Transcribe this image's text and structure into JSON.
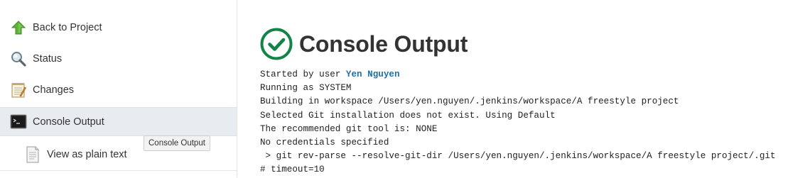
{
  "sidebar": {
    "items": [
      {
        "label": "Back to Project",
        "icon": "up-arrow-icon"
      },
      {
        "label": "Status",
        "icon": "magnifier-icon"
      },
      {
        "label": "Changes",
        "icon": "notepad-icon"
      },
      {
        "label": "Console Output",
        "icon": "terminal-icon",
        "active": true
      },
      {
        "label": "View as plain text",
        "icon": "document-icon",
        "sub": true
      }
    ]
  },
  "tooltip": {
    "text": "Console Output"
  },
  "main": {
    "title": "Console Output",
    "status_icon": "success-check-icon",
    "console": {
      "started_prefix": "Started by user ",
      "user": "Yen Nguyen",
      "lines": [
        "Running as SYSTEM",
        "Building in workspace /Users/yen.nguyen/.jenkins/workspace/A freestyle project",
        "Selected Git installation does not exist. Using Default",
        "The recommended git tool is: NONE",
        "No credentials specified",
        " > git rev-parse --resolve-git-dir /Users/yen.nguyen/.jenkins/workspace/A freestyle project/.git",
        "# timeout=10"
      ]
    }
  },
  "colors": {
    "success_green": "#138347",
    "active_bg": "#e8ecf0",
    "link_blue": "#1f6ea5"
  }
}
